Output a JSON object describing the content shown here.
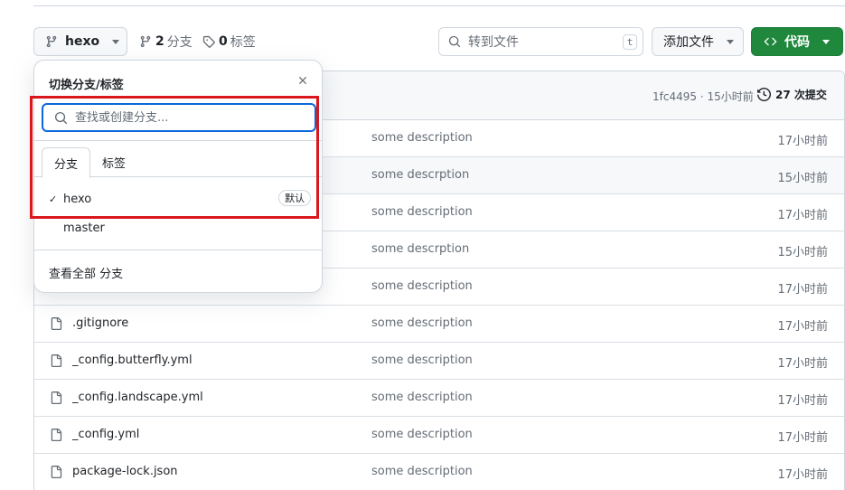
{
  "toolbar": {
    "current_branch": "hexo",
    "branch_count": "2",
    "branch_label": "分支",
    "tag_count": "0",
    "tag_label": "标签",
    "goto_placeholder": "转到文件",
    "goto_shortcut": "t",
    "add_file_label": "添加文件",
    "code_label": "代码"
  },
  "commit_bar": {
    "commit_meta": "1fc4495 · 15小时前",
    "history_label": "27 次提交"
  },
  "files": [
    {
      "name": "",
      "description": "some description",
      "time": "17小时前"
    },
    {
      "name": "",
      "description": "some descrption",
      "time": "15小时前"
    },
    {
      "name": "",
      "description": "some description",
      "time": "17小时前"
    },
    {
      "name": "",
      "description": "some descrption",
      "time": "15小时前"
    },
    {
      "name": "",
      "description": "some description",
      "time": "17小时前"
    },
    {
      "name": ".gitignore",
      "description": "some description",
      "time": "17小时前"
    },
    {
      "name": "_config.butterfly.yml",
      "description": "some description",
      "time": "17小时前"
    },
    {
      "name": "_config.landscape.yml",
      "description": "some description",
      "time": "17小时前"
    },
    {
      "name": "_config.yml",
      "description": "some description",
      "time": "17小时前"
    },
    {
      "name": "package-lock.json",
      "description": "some description",
      "time": "17小时前"
    }
  ],
  "branch_popover": {
    "title": "切换分支/标签",
    "search_placeholder": "查找或创建分支...",
    "tabs": [
      "分支",
      "标签"
    ],
    "branches": [
      {
        "name": "hexo",
        "checkmark": "✓",
        "badge": "默认"
      },
      {
        "name": "master"
      }
    ],
    "view_all": "查看全部 分支"
  },
  "colors": {
    "primary_green": "#1f883d",
    "focus_blue": "#0969da",
    "highlight_red": "#d9171c",
    "border": "#d0d7de",
    "muted_text": "#656d76"
  },
  "icons": [
    "git-branch-icon",
    "tag-icon",
    "search-icon",
    "code-icon",
    "history-icon",
    "file-icon",
    "close-icon",
    "check-icon",
    "chevron-down-icon"
  ]
}
